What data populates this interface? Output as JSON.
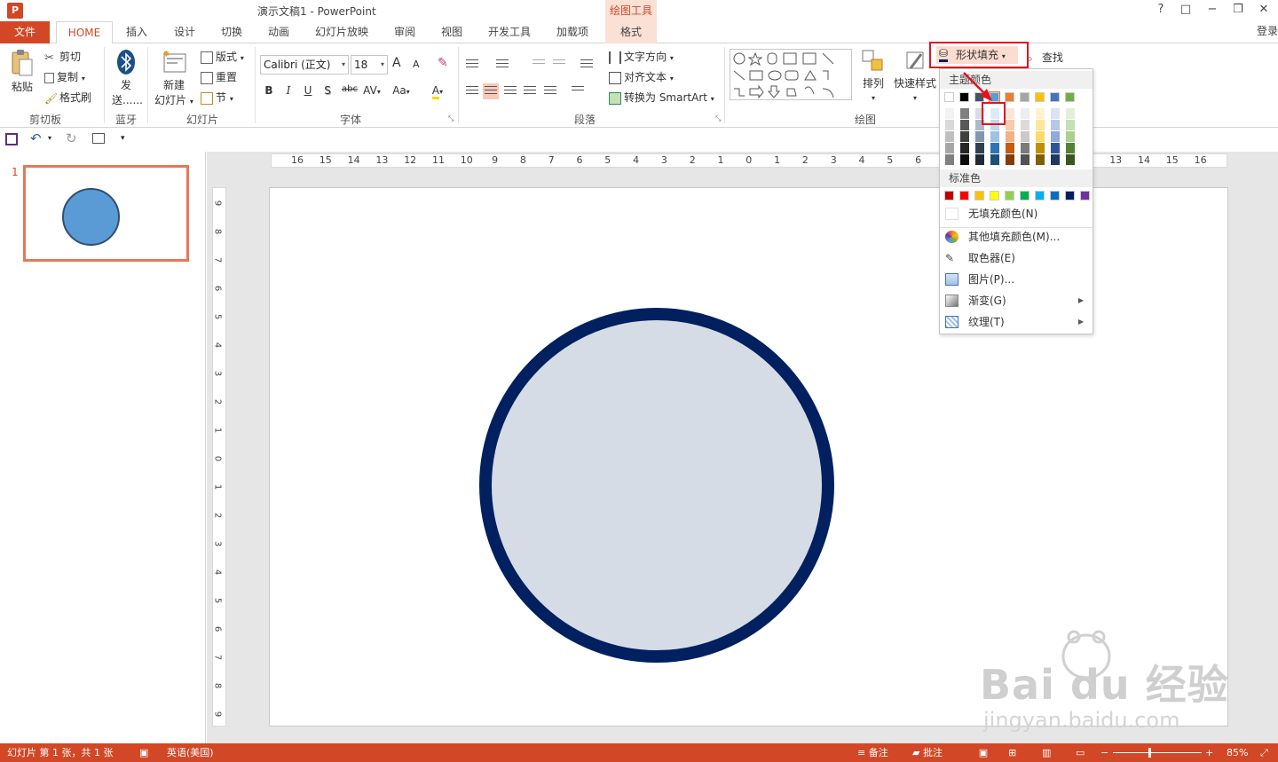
{
  "titlebar": {
    "app_icon": "P",
    "doc_title": "演示文稿1 - PowerPoint",
    "tool_context": "绘图工具",
    "help": "?",
    "restore": "□",
    "minimize": "−",
    "maximize": "❐",
    "close": "✕"
  },
  "tabs": {
    "file": "文件",
    "home": "HOME",
    "insert": "插入",
    "design": "设计",
    "transition": "切换",
    "animation": "动画",
    "slideshow": "幻灯片放映",
    "review": "审阅",
    "view": "视图",
    "developer": "开发工具",
    "addins": "加载项",
    "format": "格式",
    "login": "登录"
  },
  "ribbon": {
    "clipboard": {
      "paste": "粘贴",
      "cut": "剪切",
      "copy": "复制",
      "format_painter": "格式刷",
      "label": "剪切板"
    },
    "bluetooth": {
      "send_1": "发",
      "send_2": "送......",
      "label": "蓝牙"
    },
    "slides": {
      "new_slide_1": "新建",
      "new_slide_2": "幻灯片",
      "layout": "版式",
      "reset": "重置",
      "section": "节",
      "label": "幻灯片"
    },
    "font": {
      "font_name": "Calibri (正文)",
      "font_size": "18",
      "grow": "A",
      "shrink": "A",
      "bold": "B",
      "italic": "I",
      "underline": "U",
      "shadow": "S",
      "strike": "abc",
      "spacing": "AV",
      "case": "Aa",
      "color": "A",
      "label": "字体"
    },
    "paragraph": {
      "text_direction": "文字方向",
      "align_text": "对齐文本",
      "smartart": "转换为 SmartArt",
      "label": "段落"
    },
    "drawing": {
      "arrange": "排列",
      "quick_styles": "快速样式",
      "shape_fill": "形状填充",
      "find": "查找",
      "label": "绘图"
    }
  },
  "fill_menu": {
    "theme_colors": "主题颜色",
    "standard_colors": "标准色",
    "no_fill": "无填充颜色(N)",
    "more_colors": "其他填充颜色(M)...",
    "eyedropper": "取色器(E)",
    "picture": "图片(P)...",
    "gradient": "渐变(G)",
    "texture": "纹理(T)",
    "theme_row": [
      "#ffffff",
      "#000000",
      "#44546a",
      "#5b9bd5",
      "#ed7d31",
      "#a5a5a5",
      "#ffc000",
      "#4472c4",
      "#70ad47"
    ],
    "theme_shades": [
      [
        "#f2f2f2",
        "#7f7f7f",
        "#d6dce5",
        "#deebf7",
        "#fbe5d6",
        "#ededed",
        "#fff2cc",
        "#dae3f3",
        "#e2f0d9"
      ],
      [
        "#d9d9d9",
        "#595959",
        "#adb9ca",
        "#bdd7ee",
        "#f8cbad",
        "#dbdbdb",
        "#ffe699",
        "#b4c7e7",
        "#c5e0b4"
      ],
      [
        "#bfbfbf",
        "#404040",
        "#8497b0",
        "#9dc3e6",
        "#f4b183",
        "#c9c9c9",
        "#ffd966",
        "#8faadc",
        "#a9d18e"
      ],
      [
        "#a6a6a6",
        "#262626",
        "#333f50",
        "#2e75b6",
        "#c55a11",
        "#7b7b7b",
        "#bf9000",
        "#2f5597",
        "#548235"
      ],
      [
        "#808080",
        "#0d0d0d",
        "#222a35",
        "#1f4e79",
        "#843c0c",
        "#525252",
        "#7f6000",
        "#203864",
        "#385723"
      ]
    ],
    "standard_row": [
      "#c00000",
      "#ff0000",
      "#ffc000",
      "#ffff00",
      "#92d050",
      "#00b050",
      "#00b0f0",
      "#0070c0",
      "#002060",
      "#7030a0"
    ]
  },
  "slide_panel": {
    "thumb_number": "1"
  },
  "slide": {
    "circle_fill": "#d6dce5",
    "circle_outline": "#002060"
  },
  "ruler": {
    "h_labels": [
      "16",
      "15",
      "14",
      "13",
      "12",
      "11",
      "10",
      "9",
      "8",
      "7",
      "6",
      "5",
      "4",
      "3",
      "2",
      "1",
      "0",
      "1",
      "2",
      "3",
      "4",
      "5",
      "6",
      "7",
      "8",
      "9",
      "10",
      "11",
      "12",
      "13",
      "14",
      "15",
      "16"
    ],
    "v_labels": [
      "9",
      "8",
      "7",
      "6",
      "5",
      "4",
      "3",
      "2",
      "1",
      "0",
      "1",
      "2",
      "3",
      "4",
      "5",
      "6",
      "7",
      "8",
      "9"
    ]
  },
  "statusbar": {
    "slide_info": "幻灯片 第 1 张，共 1 张",
    "language": "英语(美国)",
    "notes": "备注",
    "comments": "批注",
    "zoom": "85%",
    "zoom_minus": "−",
    "zoom_plus": "+"
  },
  "watermark": {
    "brand": "Bai du 经验",
    "url": "jingyan.baidu.com"
  },
  "colors": {
    "accent": "#d24726",
    "highlight_red": "#e0141e",
    "format_tab": "#fbe0d6"
  }
}
